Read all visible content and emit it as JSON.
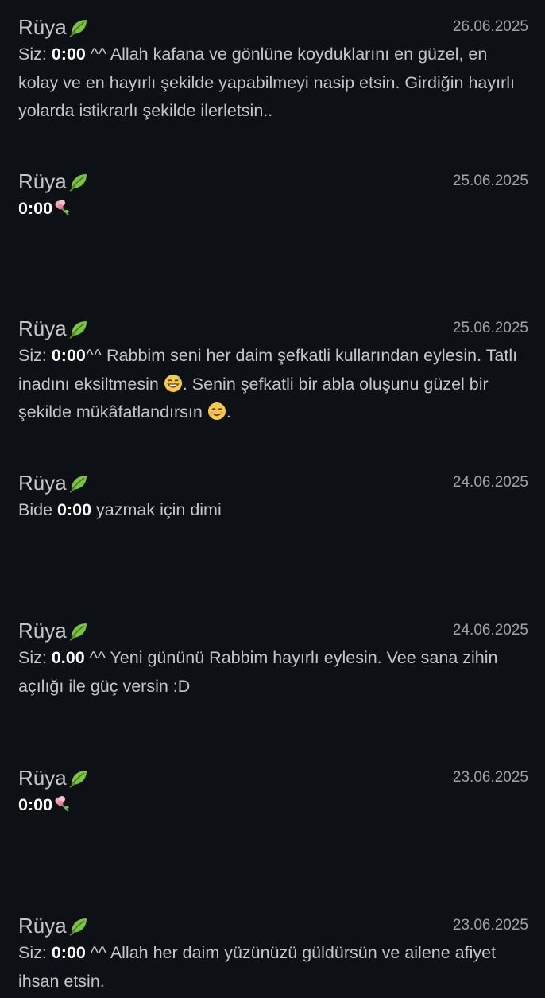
{
  "entries": [
    {
      "name": "Rüya",
      "date": "26.06.2025",
      "prefix": "Siz: ",
      "time": "0:00",
      "text": " ^^ Allah kafana ve gönlüne koyduklarını en güzel, en kolay ve en hayırlı şekilde yapabilmeyi nasip etsin. Girdiğin hayırlı yolarda istikrarlı şekilde ilerletsin..",
      "tail": ""
    },
    {
      "name": "Rüya",
      "date": "25.06.2025",
      "prefix": "",
      "time": "0:00",
      "text": "",
      "tail": ""
    },
    {
      "name": "Rüya",
      "date": "25.06.2025",
      "prefix": "Siz: ",
      "time": "0:00",
      "text": "^^  Rabbim seni her daim şefkatli kullarından eylesin.  Tatlı inadını eksiltmesin ",
      "text2": ". Senin şefkatli bir abla oluşunu güzel bir şekilde mükâfatlandırsın ",
      "tail": "."
    },
    {
      "name": "Rüya",
      "date": "24.06.2025",
      "prefix": "Bide ",
      "time": "0:00",
      "text": " yazmak için dimi",
      "tail": ""
    },
    {
      "name": "Rüya",
      "date": "24.06.2025",
      "prefix": "Siz: ",
      "time": "0.00",
      "text": " ^^ Yeni gününü Rabbim hayırlı eylesin. Vee sana zihin açılığı ile güç versin  :D",
      "tail": ""
    },
    {
      "name": "Rüya",
      "date": "23.06.2025",
      "prefix": "",
      "time": "0:00",
      "text": "",
      "tail": ""
    },
    {
      "name": "Rüya",
      "date": "23.06.2025",
      "prefix": "Siz: ",
      "time": "0:00",
      "text": " ^^ Allah her daim yüzünüzü güldürsün ve ailene afiyet ihsan etsin.",
      "tail": ""
    }
  ],
  "icons": {
    "leaf": "leaf-emoji",
    "flower": "flower-emoji",
    "laugh": "grinning-sweat-emoji",
    "smile": "smiling-blush-emoji"
  }
}
